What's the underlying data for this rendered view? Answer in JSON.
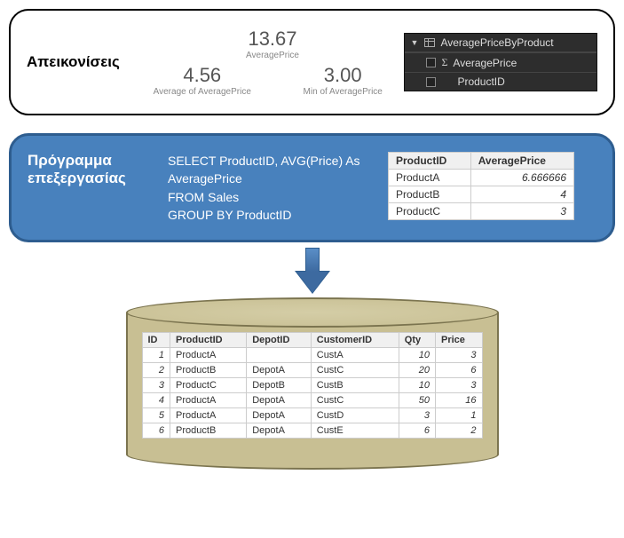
{
  "viz": {
    "label": "Απεικονίσεις",
    "metrics": [
      {
        "value": "13.67",
        "label": "AveragePrice"
      },
      {
        "value": "4.56",
        "label": "Average of AveragePrice"
      },
      {
        "value": "3.00",
        "label": "Min of AveragePrice"
      }
    ],
    "fields": {
      "tableName": "AveragePriceByProduct",
      "items": [
        {
          "icon": "sigma",
          "label": "AveragePrice"
        },
        {
          "icon": "",
          "label": "ProductID"
        }
      ]
    }
  },
  "query": {
    "label": "Πρόγραμμα επεξεργασίας",
    "sql": "SELECT ProductID, AVG(Price) As AveragePrice\nFROM Sales\nGROUP BY ProductID",
    "result": {
      "headers": [
        "ProductID",
        "AveragePrice"
      ],
      "rows": [
        [
          "ProductA",
          "6.666666"
        ],
        [
          "ProductB",
          "4"
        ],
        [
          "ProductC",
          "3"
        ]
      ]
    }
  },
  "sales": {
    "headers": [
      "ID",
      "ProductID",
      "DepotID",
      "CustomerID",
      "Qty",
      "Price"
    ],
    "rows": [
      [
        "1",
        "ProductA",
        "",
        "CustA",
        "10",
        "3"
      ],
      [
        "2",
        "ProductB",
        "DepotA",
        "CustC",
        "20",
        "6"
      ],
      [
        "3",
        "ProductC",
        "DepotB",
        "CustB",
        "10",
        "3"
      ],
      [
        "4",
        "ProductA",
        "DepotA",
        "CustC",
        "50",
        "16"
      ],
      [
        "5",
        "ProductA",
        "DepotA",
        "CustD",
        "3",
        "1"
      ],
      [
        "6",
        "ProductB",
        "DepotA",
        "CustE",
        "6",
        "2"
      ]
    ]
  }
}
